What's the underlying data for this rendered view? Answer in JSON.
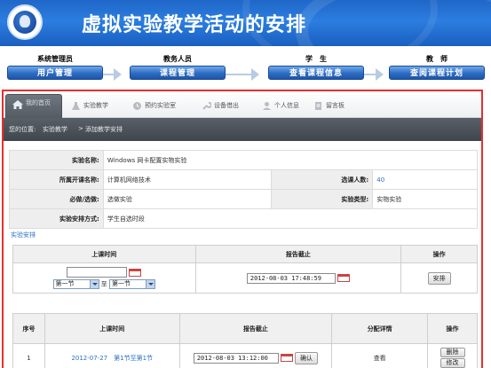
{
  "banner": {
    "title": "虚拟实验教学活动的安排"
  },
  "roles": [
    {
      "name": "系统管理员",
      "button": "用户管理"
    },
    {
      "name": "教务人员",
      "button": "课程管理"
    },
    {
      "name": "学　生",
      "button": "查看课程信息"
    },
    {
      "name": "教　师",
      "button": "查阅课程计划"
    }
  ],
  "tabs": {
    "active": "我的首页",
    "items": [
      "实验教学",
      "预约实验室",
      "设备借出",
      "个人信息",
      "留言板"
    ]
  },
  "breadcrumb": {
    "prefix": "您的位置:",
    "parent": "实验教学",
    "separator": ">",
    "current": "添加教学安排"
  },
  "info": {
    "experiment_name_label": "实验名称:",
    "experiment_name": "Windows 网卡配置实物实验",
    "course_label": "所属开课名称:",
    "course": "计算机网络技术",
    "enroll_label": "选课人数:",
    "enroll": "40",
    "required_label": "必做/选做:",
    "required": "选做实验",
    "type_label": "实验类型:",
    "type": "实物实验",
    "arrangement_label": "实验安排方式:",
    "arrangement": "学生自选时段"
  },
  "section_label": "实验安排",
  "schedule": {
    "headers": [
      "上课时间",
      "报告截止",
      "操作"
    ],
    "date_value": "",
    "from_select": "第一节",
    "to_word": "至",
    "to_select": "第一节",
    "deadline": "2012-08-03 17:48:59",
    "action_button": "安排"
  },
  "results": {
    "headers": [
      "序号",
      "上课时间",
      "报告截止",
      "分配详情",
      "操作"
    ],
    "rows": [
      {
        "index": "1",
        "time": "2012-07-27　第1节至第1节",
        "deadline": "2012-08-03 13:12:00",
        "confirm": "确认",
        "detail": "查看",
        "delete": "删除",
        "edit": "修改"
      }
    ]
  }
}
